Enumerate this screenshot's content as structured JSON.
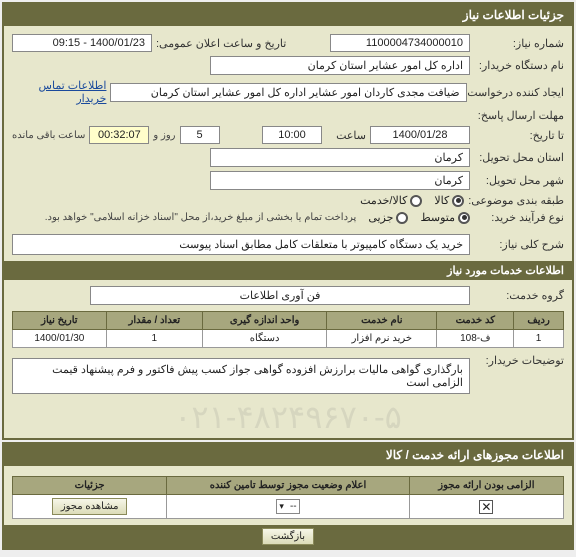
{
  "header": {
    "title": "جزئیات اطلاعات نیاز"
  },
  "fields": {
    "need_no_label": "شماره نیاز:",
    "need_no": "1100004734000010",
    "announce_label": "تاریخ و ساعت اعلان عمومی:",
    "announce": "1400/01/23 - 09:15",
    "buyer_org_label": "نام دستگاه خریدار:",
    "buyer_org": "اداره کل امور عشایر استان کرمان",
    "creator_label": "ایجاد کننده درخواست:",
    "creator": "ضیافت مجدی کاردان امور عشایر اداره کل امور عشایر استان کرمان",
    "contact_link": "اطلاعات تماس خریدار",
    "deadline_label": "مهلت ارسال پاسخ:",
    "to_date_label": "تا تاریخ:",
    "to_date": "1400/01/28",
    "time_label": "ساعت",
    "to_time": "10:00",
    "day_count": "5",
    "day_label": "روز و",
    "remaining": "00:32:07",
    "remaining_label": "ساعت باقی مانده",
    "deliv_prov_label": "استان محل تحویل:",
    "deliv_prov": "کرمان",
    "deliv_city_label": "شهر محل تحویل:",
    "deliv_city": "کرمان",
    "topic_class_label": "طبقه بندی موضوعی:",
    "opt_goods": "کالا",
    "opt_goods_service": "کالا/خدمت",
    "purchase_type_label": "نوع فرآیند خرید:",
    "opt_medium": "متوسط",
    "opt_small": "جزیی",
    "purchase_note": "پرداخت تمام یا بخشی از مبلغ خرید،از محل \"اسناد خزانه اسلامی\" خواهد بود.",
    "overall_desc_label": "شرح کلی نیاز:",
    "overall_desc": "خرید یک دستگاه کامپیوتر با متعلقات کامل مطابق اسناد پیوست"
  },
  "services_header": "اطلاعات خدمات مورد نیاز",
  "service_group_label": "گروه خدمت:",
  "service_group": "فن آوری اطلاعات",
  "table": {
    "headers": {
      "row": "ردیف",
      "code": "کد خدمت",
      "name": "نام خدمت",
      "unit": "واحد اندازه گیری",
      "qty": "تعداد / مقدار",
      "date": "تاریخ نیاز"
    },
    "rows": [
      {
        "row": "1",
        "code": "ف-108",
        "name": "خرید نرم افزار",
        "unit": "دستگاه",
        "qty": "1",
        "date": "1400/01/30"
      }
    ]
  },
  "buyer_notes_label": "توضیحات خریدار:",
  "buyer_notes": "بارگذاری گواهی مالیات برارزش افزوده گواهی جواز کسب پیش فاکتور و فرم پیشنهاد قیمت الزامی است",
  "watermark": "۰۲۱-۴۸۲۴۹۶۷۰-۵",
  "panel2": {
    "title": "اطلاعات مجوزهای ارائه خدمت / کالا",
    "table": {
      "headers": {
        "mandatory": "الزامی بودن ارائه مجوز",
        "status": "اعلام وضعیت مجوز توسط تامین کننده",
        "details": "جزئیات"
      },
      "row": {
        "status_val": "--",
        "btn": "مشاهده مجوز"
      }
    }
  },
  "footer": {
    "back": "بازگشت"
  }
}
